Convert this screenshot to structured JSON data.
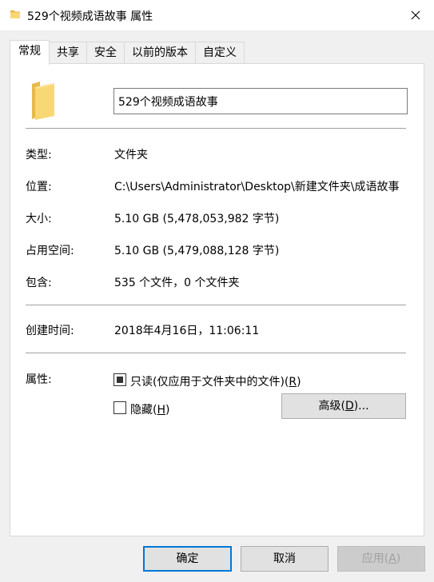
{
  "window": {
    "title": "529个视频成语故事 属性"
  },
  "tabs": [
    {
      "label": "常规",
      "active": true
    },
    {
      "label": "共享"
    },
    {
      "label": "安全"
    },
    {
      "label": "以前的版本"
    },
    {
      "label": "自定义"
    }
  ],
  "general": {
    "name": "529个视频成语故事",
    "fields": {
      "type": {
        "label": "类型:",
        "value": "文件夹"
      },
      "location": {
        "label": "位置:",
        "value": "C:\\Users\\Administrator\\Desktop\\新建文件夹\\成语故事"
      },
      "size": {
        "label": "大小:",
        "value": "5.10 GB (5,478,053,982 字节)"
      },
      "size_on_disk": {
        "label": "占用空间:",
        "value": "5.10 GB (5,479,088,128 字节)"
      },
      "contains": {
        "label": "包含:",
        "value": "535 个文件，0 个文件夹"
      },
      "created": {
        "label": "创建时间:",
        "value": "2018年4月16日，11:06:11"
      }
    },
    "attributes": {
      "label": "属性:",
      "readonly_label": "只读(仅应用于文件夹中的文件)(",
      "readonly_key": "R",
      "readonly_state": "indeterminate",
      "hidden_label": "隐藏(",
      "hidden_key": "H",
      "hidden_checked": false,
      "advanced_label": "高级(",
      "advanced_key": "D",
      "advanced_suffix": ")..."
    }
  },
  "footer": {
    "ok": "确定",
    "cancel": "取消",
    "apply_label": "应用(",
    "apply_key": "A",
    "close_paren": ")"
  },
  "colors": {
    "folder": "#f8d775",
    "folder_dark": "#e8b84a",
    "accent": "#0078d7"
  }
}
